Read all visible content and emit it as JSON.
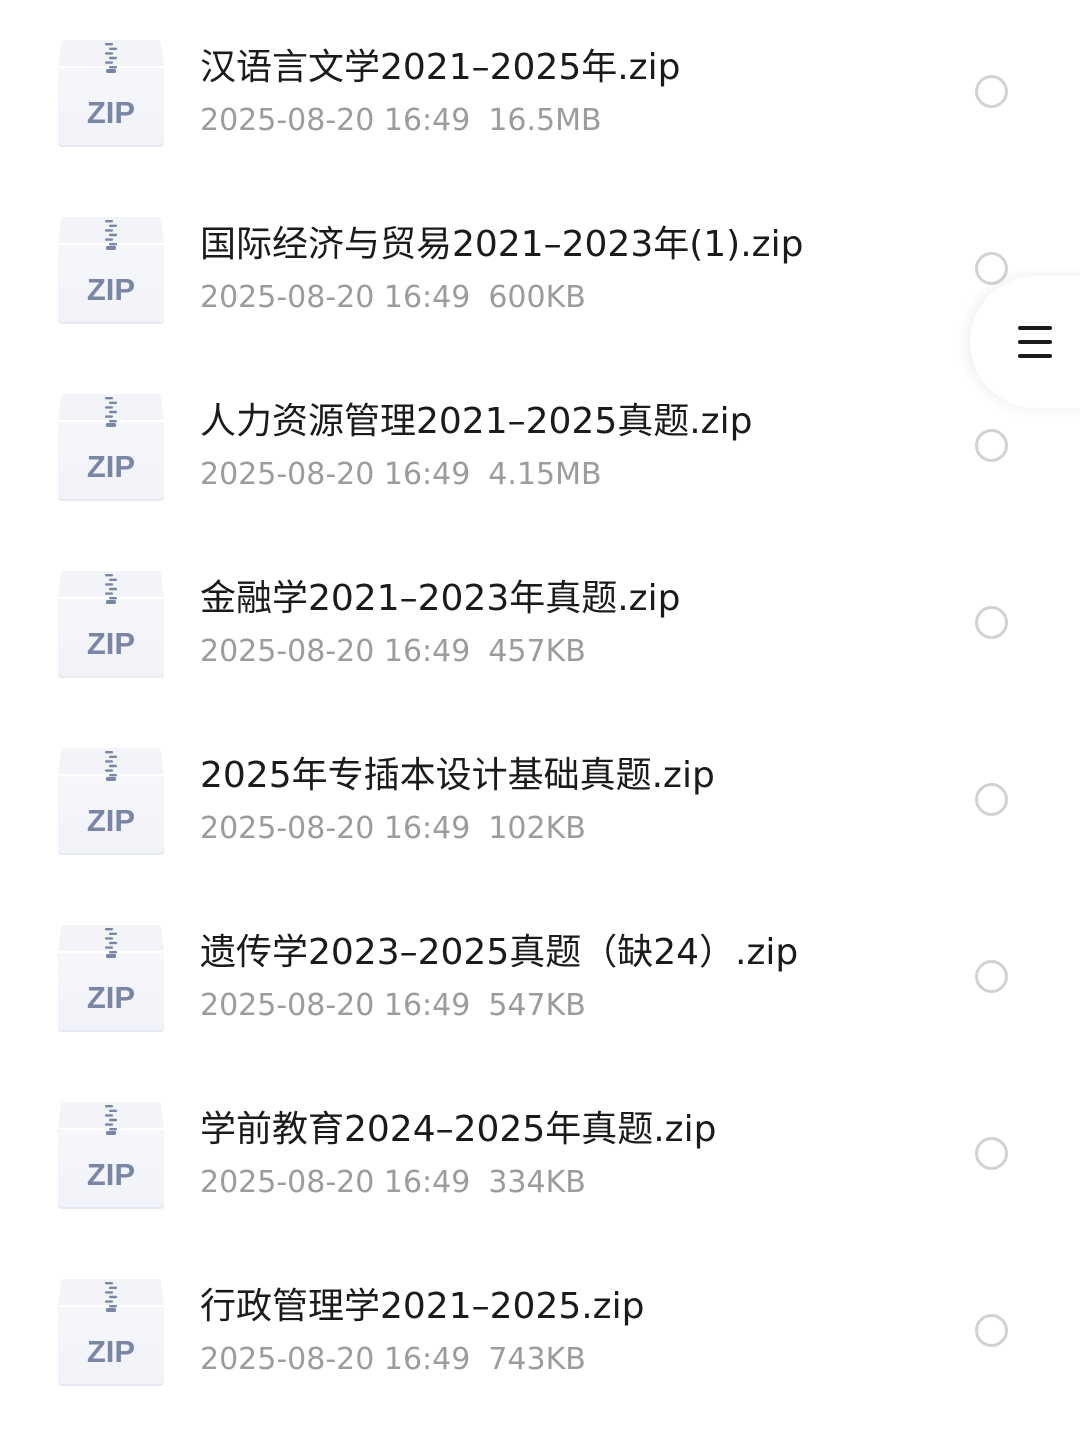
{
  "files": [
    {
      "name": "汉语言文学2021–2025年.zip",
      "date": "2025-08-20 16:49",
      "size": "16.5MB",
      "icon": "zip-file-icon",
      "icon_label": "ZIP"
    },
    {
      "name": "国际经济与贸易2021–2023年(1).zip",
      "date": "2025-08-20 16:49",
      "size": "600KB",
      "icon": "zip-file-icon",
      "icon_label": "ZIP"
    },
    {
      "name": "人力资源管理2021–2025真题.zip",
      "date": "2025-08-20 16:49",
      "size": "4.15MB",
      "icon": "zip-file-icon",
      "icon_label": "ZIP"
    },
    {
      "name": "金融学2021–2023年真题.zip",
      "date": "2025-08-20 16:49",
      "size": "457KB",
      "icon": "zip-file-icon",
      "icon_label": "ZIP"
    },
    {
      "name": "2025年专插本设计基础真题.zip",
      "date": "2025-08-20 16:49",
      "size": "102KB",
      "icon": "zip-file-icon",
      "icon_label": "ZIP"
    },
    {
      "name": "遗传学2023–2025真题（缺24）.zip",
      "date": "2025-08-20 16:49",
      "size": "547KB",
      "icon": "zip-file-icon",
      "icon_label": "ZIP"
    },
    {
      "name": "学前教育2024–2025年真题.zip",
      "date": "2025-08-20 16:49",
      "size": "334KB",
      "icon": "zip-file-icon",
      "icon_label": "ZIP"
    },
    {
      "name": "行政管理学2021–2025.zip",
      "date": "2025-08-20 16:49",
      "size": "743KB",
      "icon": "zip-file-icon",
      "icon_label": "ZIP"
    }
  ],
  "float_menu": {
    "icon": "menu-icon"
  },
  "colors": {
    "title_text": "#1b1b1b",
    "meta_text": "#9c9ca0",
    "radio_border": "#d2d2d6",
    "zip_label": "#7a86a6",
    "zip_body": "#f1f3f9"
  }
}
